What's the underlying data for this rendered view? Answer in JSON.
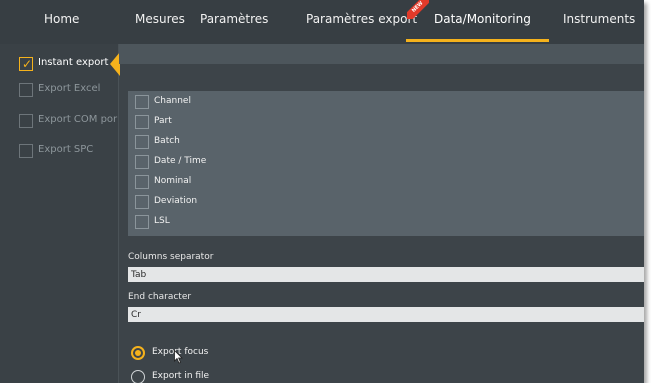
{
  "nav": {
    "tabs": [
      {
        "label": "Home"
      },
      {
        "label": "Mesures"
      },
      {
        "label": "Paramètres"
      },
      {
        "label": "Paramètres export"
      },
      {
        "label": "Data/Monitoring"
      },
      {
        "label": "Instruments"
      }
    ],
    "active_tab": "Data/Monitoring",
    "new_badge": "NEW"
  },
  "sidebar": {
    "items": [
      {
        "label": "Instant export",
        "checked": true
      },
      {
        "label": "Export Excel",
        "checked": false
      },
      {
        "label": "Export COM por",
        "checked": false
      },
      {
        "label": "Export SPC",
        "checked": false
      }
    ]
  },
  "columns": {
    "items": [
      {
        "label": "Channel",
        "checked": false
      },
      {
        "label": "Part",
        "checked": false
      },
      {
        "label": "Batch",
        "checked": false
      },
      {
        "label": "Date / Time",
        "checked": false
      },
      {
        "label": "Nominal",
        "checked": false
      },
      {
        "label": "Deviation",
        "checked": false
      },
      {
        "label": "LSL",
        "checked": false
      }
    ]
  },
  "separator": {
    "label": "Columns separator",
    "value": "Tab"
  },
  "end_char": {
    "label": "End character",
    "value": "Cr"
  },
  "output": {
    "options": [
      {
        "label": "Export focus",
        "selected": true
      },
      {
        "label": "Export in file",
        "selected": false
      }
    ]
  },
  "colors": {
    "accent": "#f5b21c",
    "background": "#3d4449",
    "panel": "#59636a",
    "ribbon": "#e23a2a"
  }
}
